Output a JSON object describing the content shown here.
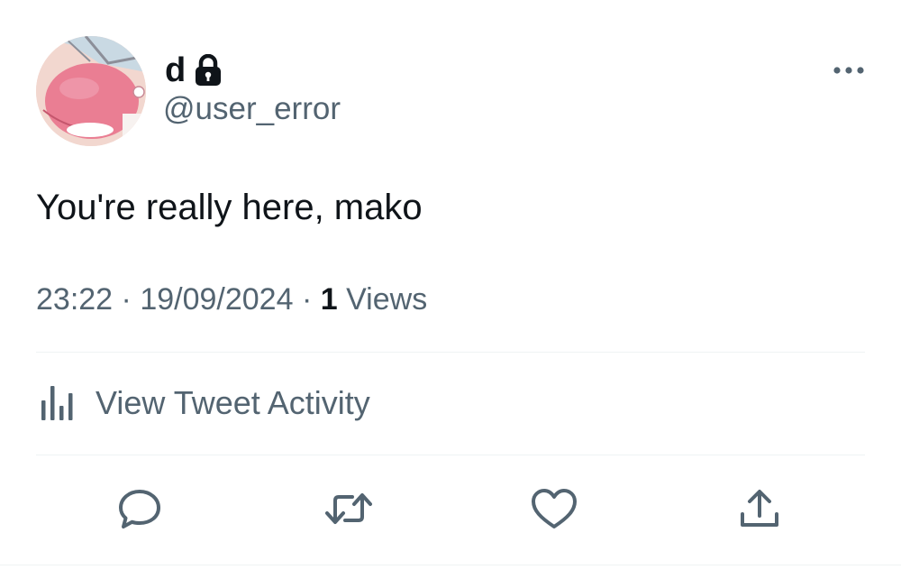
{
  "author": {
    "display_name": "d",
    "handle": "@user_error",
    "protected": true
  },
  "tweet": {
    "text": "You're really here, mako",
    "time": "23:22",
    "date": "19/09/2024",
    "separator": "·",
    "views_count": "1",
    "views_label": "Views"
  },
  "activity": {
    "label": "View Tweet Activity"
  },
  "icons": {
    "lock": "lock-icon",
    "more": "more-horizontal-icon",
    "analytics": "analytics-bars-icon",
    "reply": "reply-bubble-icon",
    "retweet": "retweet-icon",
    "like": "heart-icon",
    "share": "share-upload-icon"
  },
  "colors": {
    "text_primary": "#0f1419",
    "text_secondary": "#536471",
    "divider": "#eff3f4",
    "avatar_pink": "#ea7e93"
  }
}
